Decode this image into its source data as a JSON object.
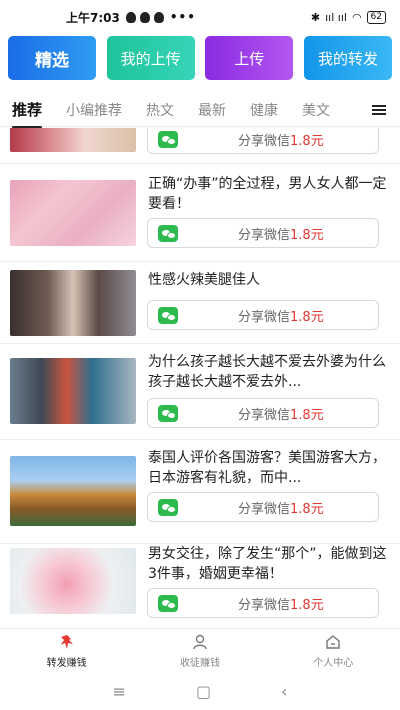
{
  "status": {
    "time": "上午7:03",
    "dots": "•••",
    "network": "ııl ııl",
    "battery": "62"
  },
  "top_buttons": [
    {
      "label": "精选"
    },
    {
      "label": "我的上传"
    },
    {
      "label": "上传"
    },
    {
      "label": "我的转发"
    }
  ],
  "tabs": [
    {
      "label": "推荐"
    },
    {
      "label": "小编推荐"
    },
    {
      "label": "热文"
    },
    {
      "label": "最新"
    },
    {
      "label": "健康"
    },
    {
      "label": "美文"
    }
  ],
  "share_prefix": "分享微信",
  "articles": [
    {
      "title": "",
      "price": "1.8元"
    },
    {
      "title": "正确“办事”的全过程，男人女人都一定要看！",
      "price": "1.8元"
    },
    {
      "title": "性感火辣美腿佳人",
      "price": "1.8元"
    },
    {
      "title": "为什么孩子越长大越不爱去外婆为什么孩子越长大越不爱去外...",
      "price": "1.8元"
    },
    {
      "title": "泰国人评价各国游客？美国游客大方，日本游客有礼貌，而中...",
      "price": "1.8元"
    },
    {
      "title": "男女交往，除了发生“那个”，能做到这3件事，婚姻更幸福！",
      "price": "1.8元"
    }
  ],
  "bottom_nav": [
    {
      "label": "转发赚钱"
    },
    {
      "label": "收徒赚钱"
    },
    {
      "label": "个人中心"
    }
  ],
  "colors": {
    "accent_red": "#e53935",
    "wechat_green": "#2dbb4f"
  }
}
